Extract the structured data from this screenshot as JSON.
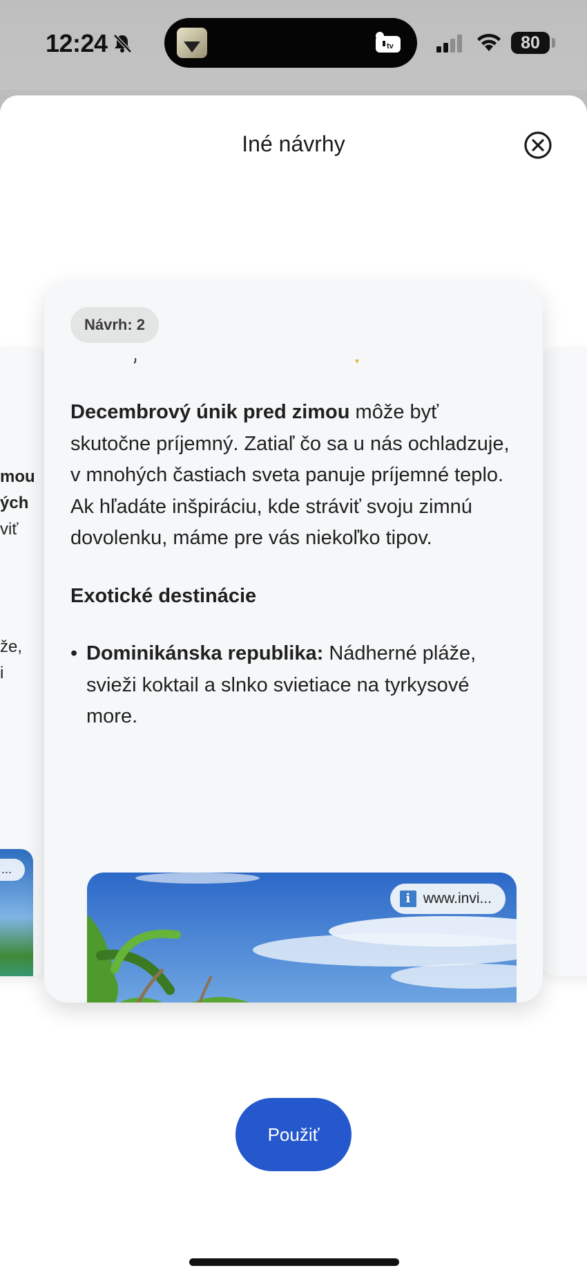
{
  "status_bar": {
    "time": "12:24",
    "battery": "80",
    "icons": [
      "bell-off-icon",
      "apple-tv-icon",
      "signal-icon",
      "wifi-icon",
      "battery-icon"
    ]
  },
  "sheet": {
    "title": "Iné návrhy"
  },
  "card": {
    "badge": "Návrh: 2",
    "intro_bold": "Decembrový únik pred zimou",
    "intro_rest": " môže byť skutočne príjemný. Zatiaľ čo sa u nás ochladzuje, v mnohých častiach sveta panuje príjemné teplo. Ak hľadáte inšpiráciu, kde stráviť svoju zimnú dovolenku, máme pre vás niekoľko tipov.",
    "heading": "Exotické destinácie",
    "bullet_bold": "Dominikánska republika:",
    "bullet_rest": " Nádherné pláže, svieži koktail a slnko svietiace na tyrkysové more.",
    "image_source": "www.invi..."
  },
  "peek_left": {
    "lines": [
      "mou",
      "ých",
      "viť",
      "že,",
      "i"
    ],
    "image_chip": "..."
  },
  "actions": {
    "apply_label": "Použiť"
  },
  "colors": {
    "accent": "#2458cc",
    "card_bg": "#f5f7f8",
    "status_bar_bg": "#bebebe"
  }
}
